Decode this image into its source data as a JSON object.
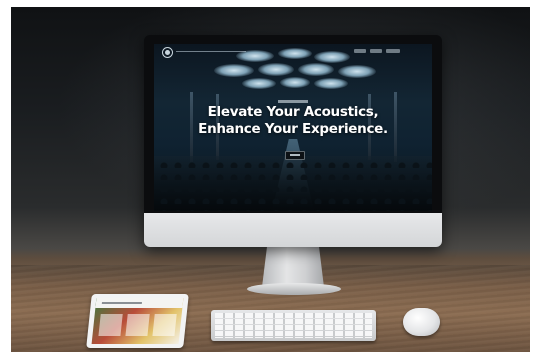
{
  "hero": {
    "title_line1": "Elevate Your Acoustics,",
    "title_line2": "Enhance Your Experience."
  },
  "colors": {
    "screen_bg": "#0f2231",
    "title_text": "#ffffff",
    "monitor_chin": "#e7e8ea"
  },
  "icons": {
    "site_logo": "circle-logo-icon"
  }
}
